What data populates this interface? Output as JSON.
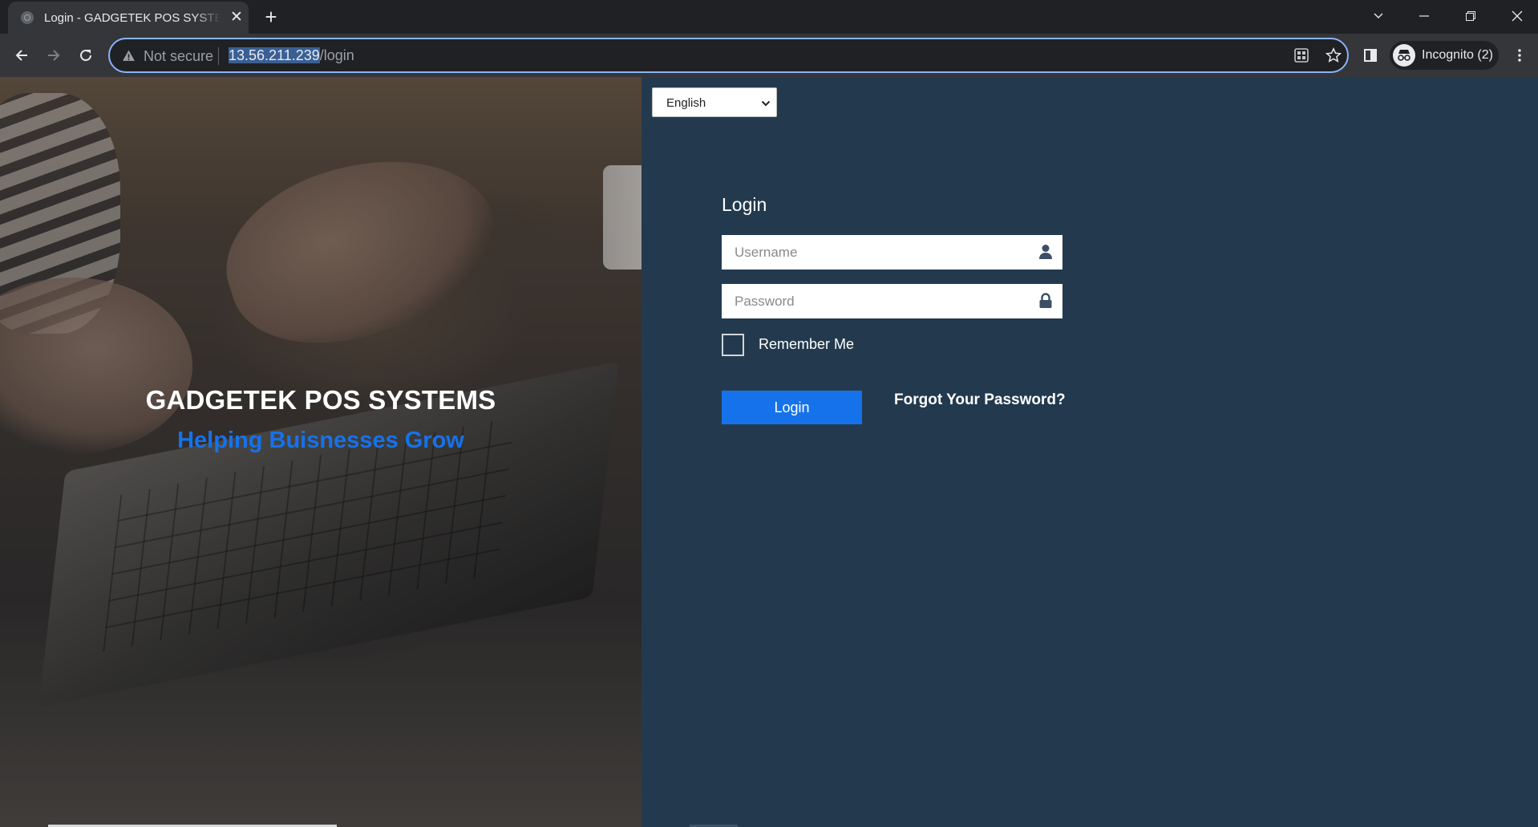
{
  "browser": {
    "tab_title": "Login - GADGETEK POS SYSTEMS",
    "address": {
      "security_label": "Not secure",
      "host": "13.56.211.239",
      "path": "/login"
    },
    "profile_label": "Incognito (2)"
  },
  "hero": {
    "title": "GADGETEK POS SYSTEMS",
    "tagline": "Helping Buisnesses Grow"
  },
  "login": {
    "language_selected": "English",
    "heading": "Login",
    "username_placeholder": "Username",
    "password_placeholder": "Password",
    "remember_label": "Remember Me",
    "submit_label": "Login",
    "forgot_label": "Forgot Your Password?"
  },
  "colors": {
    "panel_bg": "#233a4e",
    "accent": "#1672ea",
    "chrome_bg": "#202124",
    "toolbar_bg": "#35363a"
  },
  "icons": [
    "globe-icon",
    "close-icon",
    "plus-icon",
    "chevron-down-icon",
    "minimize-icon",
    "restore-icon",
    "window-close-icon",
    "back-icon",
    "forward-icon",
    "reload-icon",
    "warning-icon",
    "qr-code-icon",
    "star-icon",
    "side-panel-icon",
    "incognito-icon",
    "kebab-menu-icon",
    "user-icon",
    "lock-icon"
  ]
}
